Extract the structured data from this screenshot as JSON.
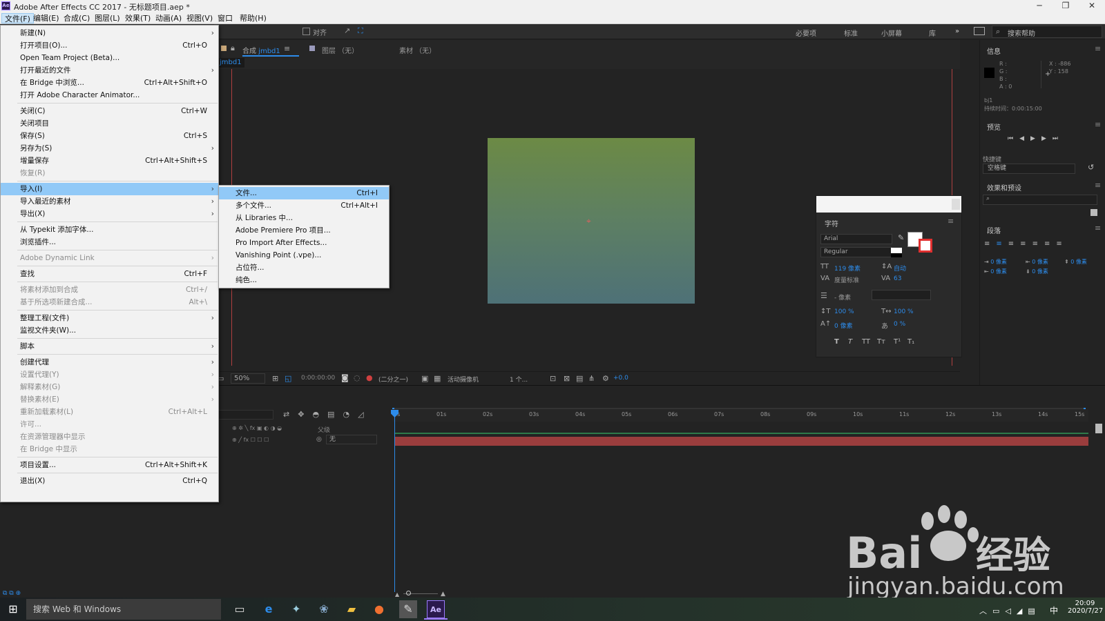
{
  "window": {
    "app_logo": "Ae",
    "title": "Adobe After Effects CC 2017 - 无标题项目.aep *",
    "controls": {
      "minimize": "─",
      "maximize": "❐",
      "close": "✕"
    }
  },
  "menubar": {
    "items": [
      "文件(F)",
      "编辑(E)",
      "合成(C)",
      "图层(L)",
      "效果(T)",
      "动画(A)",
      "视图(V)",
      "窗口",
      "帮助(H)"
    ]
  },
  "toolbar": {
    "align_label": "对齐",
    "workspaces": [
      "必要项",
      "标准",
      "小屏幕",
      "库"
    ],
    "more": "»",
    "help_search_placeholder": "搜索帮助"
  },
  "comp_panel": {
    "tab_comp_prefix": "合成",
    "tab_comp_name": "jmbd1",
    "tab_layer": "图层 （无）",
    "tab_footage": "素材 （无）",
    "subtab": "jmbd1"
  },
  "comp_footer": {
    "zoom": "50%",
    "timecode": "0:00:00:00",
    "resolution": "(二分之一)",
    "camera": "活动摄像机",
    "views": "1 个...",
    "exposure": "+0.0"
  },
  "info_panel": {
    "title": "信息",
    "r": "R :",
    "g": "G :",
    "b": "B :",
    "a": "A : 0",
    "x": "X : -886",
    "y": "Y : 158",
    "name": "bj1",
    "duration": "持续时间：0:00:15:00"
  },
  "preview_panel": {
    "title": "预览",
    "shortcut_label": "快捷键",
    "shortcut_value": "空格键"
  },
  "effects_panel": {
    "title": "效果和预设"
  },
  "paragraph_panel": {
    "title": "段落",
    "indent_values": [
      "0 像素",
      "0 像素",
      "0 像素",
      "0 像素",
      "0 像素"
    ]
  },
  "character_panel": {
    "title": "字符",
    "font": "Arial",
    "style": "Regular",
    "size": "119 像素",
    "leading": "自动",
    "kerning": "度量标准",
    "tracking": "63",
    "stroke": "- 像素",
    "vscale": "100 %",
    "hscale": "100 %",
    "baseline": "0 像素",
    "tsume": "0 %",
    "styles": [
      "T",
      "T",
      "TT",
      "Tт",
      "T¹",
      "T₁"
    ]
  },
  "timeline": {
    "ruler": [
      "0s",
      "01s",
      "02s",
      "03s",
      "04s",
      "05s",
      "06s",
      "07s",
      "08s",
      "09s",
      "10s",
      "11s",
      "12s",
      "13s",
      "14s",
      "15s"
    ],
    "parent_header": "父级",
    "parent_value": "无"
  },
  "file_menu": [
    {
      "label": "新建(N)",
      "shortcut": "",
      "arrow": true,
      "disabled": false
    },
    {
      "label": "打开项目(O)...",
      "shortcut": "Ctrl+O",
      "arrow": false,
      "disabled": false
    },
    {
      "label": "Open Team Project (Beta)...",
      "shortcut": "",
      "arrow": false,
      "disabled": false
    },
    {
      "label": "打开最近的文件",
      "shortcut": "",
      "arrow": true,
      "disabled": false
    },
    {
      "label": "在 Bridge 中浏览...",
      "shortcut": "Ctrl+Alt+Shift+O",
      "arrow": false,
      "disabled": false
    },
    {
      "label": "打开 Adobe Character Animator...",
      "shortcut": "",
      "arrow": false,
      "disabled": false
    },
    {
      "sep": true
    },
    {
      "label": "关闭(C)",
      "shortcut": "Ctrl+W",
      "arrow": false,
      "disabled": false
    },
    {
      "label": "关闭项目",
      "shortcut": "",
      "arrow": false,
      "disabled": false
    },
    {
      "label": "保存(S)",
      "shortcut": "Ctrl+S",
      "arrow": false,
      "disabled": false
    },
    {
      "label": "另存为(S)",
      "shortcut": "",
      "arrow": true,
      "disabled": false
    },
    {
      "label": "增量保存",
      "shortcut": "Ctrl+Alt+Shift+S",
      "arrow": false,
      "disabled": false
    },
    {
      "label": "恢复(R)",
      "shortcut": "",
      "arrow": false,
      "disabled": true
    },
    {
      "sep": true
    },
    {
      "label": "导入(I)",
      "shortcut": "",
      "arrow": true,
      "disabled": false,
      "highlight": true
    },
    {
      "label": "导入最近的素材",
      "shortcut": "",
      "arrow": true,
      "disabled": false
    },
    {
      "label": "导出(X)",
      "shortcut": "",
      "arrow": true,
      "disabled": false
    },
    {
      "sep": true
    },
    {
      "label": "从 Typekit 添加字体...",
      "shortcut": "",
      "arrow": false,
      "disabled": false
    },
    {
      "label": "浏览插件...",
      "shortcut": "",
      "arrow": false,
      "disabled": false
    },
    {
      "sep": true
    },
    {
      "label": "Adobe Dynamic Link",
      "shortcut": "",
      "arrow": true,
      "disabled": true
    },
    {
      "sep": true
    },
    {
      "label": "查找",
      "shortcut": "Ctrl+F",
      "arrow": false,
      "disabled": false
    },
    {
      "sep": true
    },
    {
      "label": "将素材添加到合成",
      "shortcut": "Ctrl+/",
      "arrow": false,
      "disabled": true
    },
    {
      "label": "基于所选项新建合成...",
      "shortcut": "Alt+\\",
      "arrow": false,
      "disabled": true
    },
    {
      "sep": true
    },
    {
      "label": "整理工程(文件)",
      "shortcut": "",
      "arrow": true,
      "disabled": false
    },
    {
      "label": "监视文件夹(W)...",
      "shortcut": "",
      "arrow": false,
      "disabled": false
    },
    {
      "sep": true
    },
    {
      "label": "脚本",
      "shortcut": "",
      "arrow": true,
      "disabled": false
    },
    {
      "sep": true
    },
    {
      "label": "创建代理",
      "shortcut": "",
      "arrow": true,
      "disabled": false
    },
    {
      "label": "设置代理(Y)",
      "shortcut": "",
      "arrow": true,
      "disabled": true
    },
    {
      "label": "解释素材(G)",
      "shortcut": "",
      "arrow": true,
      "disabled": true
    },
    {
      "label": "替换素材(E)",
      "shortcut": "",
      "arrow": true,
      "disabled": true
    },
    {
      "label": "重新加载素材(L)",
      "shortcut": "Ctrl+Alt+L",
      "arrow": false,
      "disabled": true
    },
    {
      "label": "许可...",
      "shortcut": "",
      "arrow": false,
      "disabled": true
    },
    {
      "label": "在资源管理器中显示",
      "shortcut": "",
      "arrow": false,
      "disabled": true
    },
    {
      "label": "在 Bridge 中显示",
      "shortcut": "",
      "arrow": false,
      "disabled": true
    },
    {
      "sep": true
    },
    {
      "label": "项目设置...",
      "shortcut": "Ctrl+Alt+Shift+K",
      "arrow": false,
      "disabled": false
    },
    {
      "sep": true
    },
    {
      "label": "退出(X)",
      "shortcut": "Ctrl+Q",
      "arrow": false,
      "disabled": false
    }
  ],
  "import_menu": [
    {
      "label": "文件...",
      "shortcut": "Ctrl+I",
      "highlight": true
    },
    {
      "label": "多个文件...",
      "shortcut": "Ctrl+Alt+I"
    },
    {
      "label": "从 Libraries 中...",
      "shortcut": ""
    },
    {
      "label": "Adobe Premiere Pro 项目...",
      "shortcut": ""
    },
    {
      "label": "Pro Import After Effects...",
      "shortcut": ""
    },
    {
      "label": "Vanishing Point (.vpe)...",
      "shortcut": ""
    },
    {
      "label": "占位符...",
      "shortcut": ""
    },
    {
      "label": "纯色...",
      "shortcut": ""
    }
  ],
  "taskbar": {
    "search_placeholder": "搜索 Web 和 Windows",
    "time": "20:09",
    "date": "2020/7/27",
    "ime": "中"
  },
  "watermark": {
    "brand": "Bai",
    "brand2": "经验",
    "url": "jingyan.baidu.com"
  },
  "colors": {
    "accent": "#2d8ceb",
    "menu_highlight": "#91c9f7",
    "layer_bar": "#9a3d3d"
  }
}
